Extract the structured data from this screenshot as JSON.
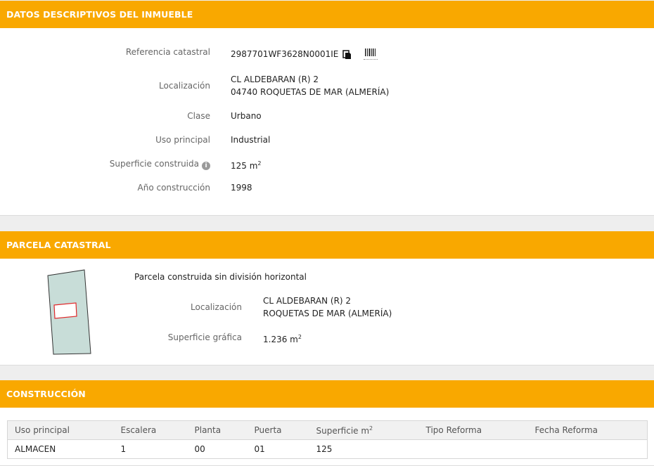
{
  "datos": {
    "header": "DATOS DESCRIPTIVOS DEL INMUEBLE",
    "ref_label": "Referencia catastral",
    "ref_value": "2987701WF3628N0001IE",
    "loc_label": "Localización",
    "loc_line1": "CL ALDEBARAN (R) 2",
    "loc_line2": "04740 ROQUETAS DE MAR (ALMERÍA)",
    "clase_label": "Clase",
    "clase_value": "Urbano",
    "uso_label": "Uso principal",
    "uso_value": "Industrial",
    "sup_label": "Superficie construida",
    "sup_value": "125 m",
    "sup_unit_sup": "2",
    "anio_label": "Año construcción",
    "anio_value": "1998",
    "info_icon": "i"
  },
  "parcela": {
    "header": "PARCELA CATASTRAL",
    "title": "Parcela construida sin división horizontal",
    "loc_label": "Localización",
    "loc_line1": "CL ALDEBARAN (R) 2",
    "loc_line2": "ROQUETAS DE MAR (ALMERÍA)",
    "sup_label": "Superficie gráfica",
    "sup_value": "1.236 m",
    "sup_unit_sup": "2"
  },
  "construccion": {
    "header": "CONSTRUCCIÓN",
    "columns": [
      "Uso principal",
      "Escalera",
      "Planta",
      "Puerta",
      "Superficie m",
      "Tipo Reforma",
      "Fecha Reforma"
    ],
    "sup_col_sup": "2",
    "rows": [
      [
        "ALMACEN",
        "1",
        "00",
        "01",
        "125",
        "",
        ""
      ]
    ]
  },
  "colors": {
    "accent": "#f9a800",
    "plot_fill": "#c8ddd8",
    "building_outline": "#e0282a"
  }
}
